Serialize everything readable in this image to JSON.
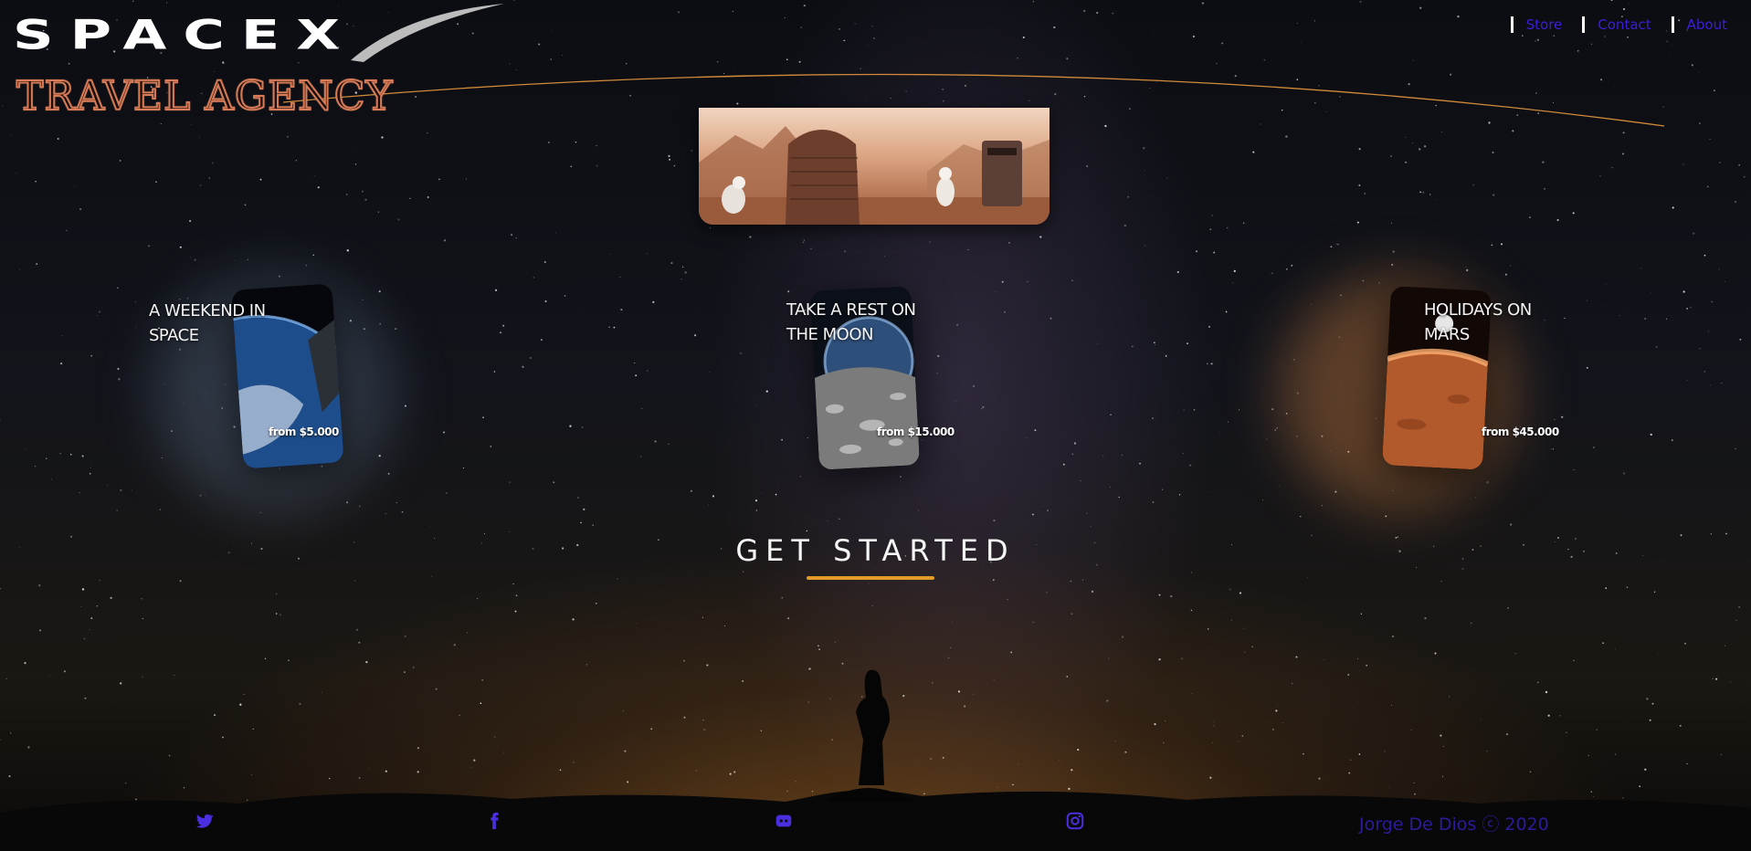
{
  "brand": {
    "name": "SPACEX",
    "tagline": "TRAVEL AGENCY"
  },
  "nav": [
    {
      "label": "Store"
    },
    {
      "label": "Contact"
    },
    {
      "label": "About"
    }
  ],
  "cards": [
    {
      "title_line1": "A WEEKEND IN",
      "title_line2": "SPACE",
      "price": "from $5.000"
    },
    {
      "title_line1": "TAKE A REST ON",
      "title_line2": "THE MOON",
      "price": "from $15.000"
    },
    {
      "title_line1": "HOLIDAYS ON",
      "title_line2": "MARS",
      "price": "from $45.000"
    }
  ],
  "cta": {
    "label": "GET STARTED"
  },
  "footer": {
    "icons": [
      "twitter-icon",
      "facebook-icon",
      "discord-icon",
      "instagram-icon"
    ],
    "copyright": "Jorge De Dios ⓒ 2020"
  },
  "colors": {
    "nav_link": "#3a1fd8",
    "nav_divider": "#ffffff",
    "cta_underline": "#e39b2a",
    "footer_icons": "#4a2fe0",
    "tagline_outline": "#d77a56"
  }
}
